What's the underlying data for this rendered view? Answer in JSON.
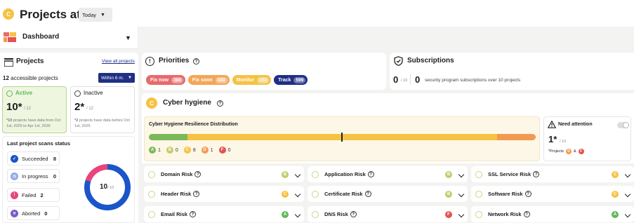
{
  "colors": {
    "brand": "#f6c243",
    "grade_a": "#5fb85a",
    "grade_b": "#c0cd6a",
    "grade_c": "#f6c243",
    "grade_d": "#f29a4f",
    "grade_f": "#e7514e",
    "navy": "#1f2f85",
    "donut_blue": "#1a55c9",
    "donut_pink": "#e8457c"
  },
  "header": {
    "logo_letter": "C",
    "title": "Projects at",
    "date_select": "Today"
  },
  "dashboard_select": {
    "label": "Dashboard"
  },
  "projects": {
    "title": "Projects",
    "view_all": "View all projects",
    "accessible_count": "12",
    "accessible_label": "accessible projects",
    "within_select": "Within 6 m.",
    "active": {
      "label": "Active",
      "value": "10*",
      "total": "/ 12",
      "note_count": "*10",
      "note": "projects have data from Oct 1st, 2025 to Apr 1st, 2026"
    },
    "inactive": {
      "label": "Inactive",
      "value": "2*",
      "total": "/ 12",
      "note_count": "*2",
      "note": "projects have data before Oct 1st, 2025"
    }
  },
  "scans": {
    "title": "Last project scans status",
    "items": [
      {
        "label": "Succeeded",
        "count": "8",
        "icon": "check-icon",
        "color": "#1a55c9"
      },
      {
        "label": "In progress",
        "count": "0",
        "icon": "clock-icon",
        "color": "#8fa9e8"
      },
      {
        "label": "Failed",
        "count": "2",
        "icon": "exclamation-icon",
        "color": "#e8457c"
      },
      {
        "label": "Aborted",
        "count": "0",
        "icon": "x-icon",
        "color": "#7a5bc7"
      }
    ],
    "donut": {
      "value": "10",
      "total": "/ 10",
      "succeeded": 8,
      "failed": 2
    }
  },
  "priorities": {
    "title": "Priorities",
    "pills": [
      {
        "label": "Fix now",
        "count": "388",
        "color": "#e86a6a"
      },
      {
        "label": "Fix soon",
        "count": "343",
        "color": "#f3a657"
      },
      {
        "label": "Monitor",
        "count": "153",
        "color": "#f6c243"
      },
      {
        "label": "Track",
        "count": "599",
        "color": "#1f2f85"
      }
    ]
  },
  "subscriptions": {
    "title": "Subscriptions",
    "value": "0",
    "total": "/ 10",
    "count": "0",
    "text": "security program subscriptions over 10 projects"
  },
  "cyber": {
    "title": "Cyber hygiene",
    "grade": "C",
    "distribution_title": "Cyber Hygiene Resilience Distribution",
    "distribution": {
      "a": 1,
      "b": 0,
      "c": 8,
      "d": 1,
      "f": 0
    },
    "legend": [
      {
        "grade": "A",
        "count": "1",
        "color": "#5fb85a"
      },
      {
        "grade": "B",
        "count": "0",
        "color": "#c0cd6a"
      },
      {
        "grade": "C",
        "count": "8",
        "color": "#f6c243"
      },
      {
        "grade": "D",
        "count": "1",
        "color": "#f29a4f"
      },
      {
        "grade": "F",
        "count": "0",
        "color": "#e7514e"
      }
    ],
    "need_attention": {
      "title": "Need attention",
      "value": "1*",
      "total": "/ 10",
      "note": "*Projects",
      "and": "&",
      "g1": "D",
      "g2": "F"
    }
  },
  "risks": [
    {
      "name": "Domain Risk",
      "grade": "B",
      "color": "#c0cd6a"
    },
    {
      "name": "Application Risk",
      "grade": "B",
      "color": "#c0cd6a"
    },
    {
      "name": "SSL Service Risk",
      "grade": "C",
      "color": "#f6c243"
    },
    {
      "name": "Header Risk",
      "grade": "C",
      "color": "#f6c243"
    },
    {
      "name": "Certificate Risk",
      "grade": "B",
      "color": "#c0cd6a"
    },
    {
      "name": "Software Risk",
      "grade": "C",
      "color": "#f6c243"
    },
    {
      "name": "Email Risk",
      "grade": "A",
      "color": "#5fb85a"
    },
    {
      "name": "DNS Risk",
      "grade": "F",
      "color": "#e7514e"
    },
    {
      "name": "Network Risk",
      "grade": "A",
      "color": "#5fb85a"
    }
  ]
}
